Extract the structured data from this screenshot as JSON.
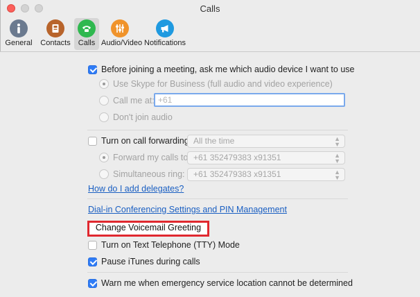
{
  "window": {
    "title": "Calls"
  },
  "toolbar": {
    "items": [
      {
        "label": "General",
        "color": "#6b7a8f",
        "icon": "info-icon"
      },
      {
        "label": "Contacts",
        "color": "#b8642b",
        "icon": "address-book-icon"
      },
      {
        "label": "Calls",
        "color": "#2fb84f",
        "icon": "phone-icon",
        "selected": true
      },
      {
        "label": "Audio/Video",
        "color": "#f0932b",
        "icon": "sliders-icon"
      },
      {
        "label": "Notifications",
        "color": "#1f9ae0",
        "icon": "megaphone-icon"
      }
    ]
  },
  "audio": {
    "ask_device_label": "Before joining a meeting, ask me which audio device I want to use",
    "ask_device_checked": true,
    "use_skype_label": "Use Skype for Business (full audio and video experience)",
    "call_me_label": "Call me at:",
    "call_me_placeholder": "+61",
    "dont_join_label": "Don't join audio"
  },
  "forwarding": {
    "turn_on_label": "Turn on call forwarding",
    "turn_on_checked": false,
    "mode_select": "All the time",
    "forward_label": "Forward my calls to:",
    "forward_value": "+61 352479383 x91351",
    "simultaneous_label": "Simultaneous ring:",
    "simultaneous_value": "+61 352479383 x91351",
    "delegates_link": "How do I add delegates?"
  },
  "dialin_link": "Dial-in Conferencing Settings and PIN Management",
  "voicemail_button": "Change Voicemail Greeting",
  "tty": {
    "label": "Turn on Text Telephone (TTY) Mode",
    "checked": false
  },
  "itunes": {
    "label": "Pause iTunes during calls",
    "checked": true
  },
  "emergency": {
    "label": "Warn me when emergency service location cannot be determined",
    "checked": true
  },
  "colors": {
    "accent": "#2f7cf6",
    "link": "#1a5fc2",
    "highlight": "#e0282f"
  }
}
